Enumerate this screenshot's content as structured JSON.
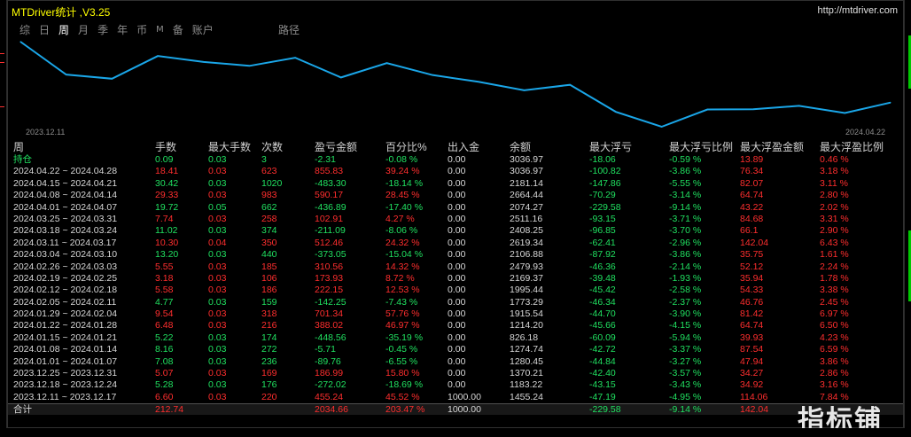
{
  "title": "MTDriver统计 ,V3.25",
  "link": "http://mtdriver.com",
  "tabs": [
    "综",
    "日",
    "周",
    "月",
    "季",
    "年",
    "币",
    "M",
    "备",
    "账户"
  ],
  "active_tab": 2,
  "route": "路径",
  "chart": {
    "start_date": "2023.12.11",
    "end_date": "2024.04.22",
    "line_color": "#1aa6e8",
    "balance": [
      1455.24,
      1183.22,
      1370.21,
      1280.45,
      1274.74,
      826.18,
      1214.2,
      1915.54,
      1773.29,
      1995.44,
      2169.37,
      2479.93,
      2106.88,
      2619.34,
      2408.25,
      2511.16,
      2664.44,
      2074.27,
      2181.14,
      3036.97
    ]
  },
  "colors": {
    "profit": "#20e060",
    "loss": "#ff2e2e",
    "neutral": "#d8d8d8",
    "title": "#ffff00"
  },
  "headers": [
    "周",
    "手数",
    "最大手数",
    "次数",
    "盈亏金额",
    "百分比%",
    "出入金",
    "余额",
    "最大浮亏",
    "最大浮亏比例",
    "最大浮盈金额",
    "最大浮盈比例"
  ],
  "position_row": {
    "c": [
      "持仓",
      "0.09",
      "0.03",
      "3",
      "-2.31",
      "-0.08 %",
      "0.00",
      "3036.97",
      "-18.06",
      "-0.59 %",
      "13.89",
      "0.46 %"
    ],
    "t": "g"
  },
  "rows": [
    {
      "c": [
        "2024.04.22 ~ 2024.04.28",
        "18.41",
        "0.03",
        "623",
        "855.83",
        "39.24 %",
        "0.00",
        "3036.97",
        "-100.82",
        "-3.86 %",
        "76.34",
        "3.18 %"
      ],
      "t": "r"
    },
    {
      "c": [
        "2024.04.15 ~ 2024.04.21",
        "30.42",
        "0.03",
        "1020",
        "-483.30",
        "-18.14 %",
        "0.00",
        "2181.14",
        "-147.86",
        "-5.55 %",
        "82.07",
        "3.11 %"
      ],
      "t": "g"
    },
    {
      "c": [
        "2024.04.08 ~ 2024.04.14",
        "29.33",
        "0.03",
        "983",
        "590.17",
        "28.45 %",
        "0.00",
        "2664.44",
        "-70.29",
        "-3.14 %",
        "64.74",
        "2.80 %"
      ],
      "t": "r"
    },
    {
      "c": [
        "2024.04.01 ~ 2024.04.07",
        "19.72",
        "0.05",
        "662",
        "-436.89",
        "-17.40 %",
        "0.00",
        "2074.27",
        "-229.58",
        "-9.14 %",
        "43.22",
        "2.02 %"
      ],
      "t": "g"
    },
    {
      "c": [
        "2024.03.25 ~ 2024.03.31",
        "7.74",
        "0.03",
        "258",
        "102.91",
        "4.27 %",
        "0.00",
        "2511.16",
        "-93.15",
        "-3.71 %",
        "84.68",
        "3.31 %"
      ],
      "t": "r"
    },
    {
      "c": [
        "2024.03.18 ~ 2024.03.24",
        "11.02",
        "0.03",
        "374",
        "-211.09",
        "-8.06 %",
        "0.00",
        "2408.25",
        "-96.85",
        "-3.70 %",
        "66.1",
        "2.90 %"
      ],
      "t": "g"
    },
    {
      "c": [
        "2024.03.11 ~ 2024.03.17",
        "10.30",
        "0.04",
        "350",
        "512.46",
        "24.32 %",
        "0.00",
        "2619.34",
        "-62.41",
        "-2.96 %",
        "142.04",
        "6.43 %"
      ],
      "t": "r"
    },
    {
      "c": [
        "2024.03.04 ~ 2024.03.10",
        "13.20",
        "0.03",
        "440",
        "-373.05",
        "-15.04 %",
        "0.00",
        "2106.88",
        "-87.92",
        "-3.86 %",
        "35.75",
        "1.61 %"
      ],
      "t": "g"
    },
    {
      "c": [
        "2024.02.26 ~ 2024.03.03",
        "5.55",
        "0.03",
        "185",
        "310.56",
        "14.32 %",
        "0.00",
        "2479.93",
        "-46.36",
        "-2.14 %",
        "52.12",
        "2.24 %"
      ],
      "t": "r"
    },
    {
      "c": [
        "2024.02.19 ~ 2024.02.25",
        "3.18",
        "0.03",
        "106",
        "173.93",
        "8.72 %",
        "0.00",
        "2169.37",
        "-39.48",
        "-1.93 %",
        "35.94",
        "1.78 %"
      ],
      "t": "r"
    },
    {
      "c": [
        "2024.02.12 ~ 2024.02.18",
        "5.58",
        "0.03",
        "186",
        "222.15",
        "12.53 %",
        "0.00",
        "1995.44",
        "-45.42",
        "-2.58 %",
        "54.33",
        "3.38 %"
      ],
      "t": "r"
    },
    {
      "c": [
        "2024.02.05 ~ 2024.02.11",
        "4.77",
        "0.03",
        "159",
        "-142.25",
        "-7.43 %",
        "0.00",
        "1773.29",
        "-46.34",
        "-2.37 %",
        "46.76",
        "2.45 %"
      ],
      "t": "g"
    },
    {
      "c": [
        "2024.01.29 ~ 2024.02.04",
        "9.54",
        "0.03",
        "318",
        "701.34",
        "57.76 %",
        "0.00",
        "1915.54",
        "-44.70",
        "-3.90 %",
        "81.42",
        "6.97 %"
      ],
      "t": "r"
    },
    {
      "c": [
        "2024.01.22 ~ 2024.01.28",
        "6.48",
        "0.03",
        "216",
        "388.02",
        "46.97 %",
        "0.00",
        "1214.20",
        "-45.66",
        "-4.15 %",
        "64.74",
        "6.50 %"
      ],
      "t": "r"
    },
    {
      "c": [
        "2024.01.15 ~ 2024.01.21",
        "5.22",
        "0.03",
        "174",
        "-448.56",
        "-35.19 %",
        "0.00",
        "826.18",
        "-60.09",
        "-5.94 %",
        "39.93",
        "4.23 %"
      ],
      "t": "g"
    },
    {
      "c": [
        "2024.01.08 ~ 2024.01.14",
        "8.16",
        "0.03",
        "272",
        "-5.71",
        "-0.45 %",
        "0.00",
        "1274.74",
        "-42.72",
        "-3.37 %",
        "87.54",
        "6.59 %"
      ],
      "t": "g"
    },
    {
      "c": [
        "2024.01.01 ~ 2024.01.07",
        "7.08",
        "0.03",
        "236",
        "-89.76",
        "-6.55 %",
        "0.00",
        "1280.45",
        "-44.84",
        "-3.27 %",
        "47.94",
        "3.86 %"
      ],
      "t": "g"
    },
    {
      "c": [
        "2023.12.25 ~ 2023.12.31",
        "5.07",
        "0.03",
        "169",
        "186.99",
        "15.80 %",
        "0.00",
        "1370.21",
        "-42.40",
        "-3.57 %",
        "34.27",
        "2.86 %"
      ],
      "t": "r"
    },
    {
      "c": [
        "2023.12.18 ~ 2023.12.24",
        "5.28",
        "0.03",
        "176",
        "-272.02",
        "-18.69 %",
        "0.00",
        "1183.22",
        "-43.15",
        "-3.43 %",
        "34.92",
        "3.16 %"
      ],
      "t": "g"
    },
    {
      "c": [
        "2023.12.11 ~ 2023.12.17",
        "6.60",
        "0.03",
        "220",
        "455.24",
        "45.52 %",
        "1000.00",
        "1455.24",
        "-47.19",
        "-4.95 %",
        "114.06",
        "7.84 %"
      ],
      "t": "r"
    }
  ],
  "total_row": {
    "c": [
      "合计",
      "212.74",
      "",
      "",
      "2034.66",
      "203.47 %",
      "1000.00",
      "",
      "-229.58",
      "-9.14 %",
      "142.04",
      ""
    ]
  },
  "watermark": "指标铺"
}
